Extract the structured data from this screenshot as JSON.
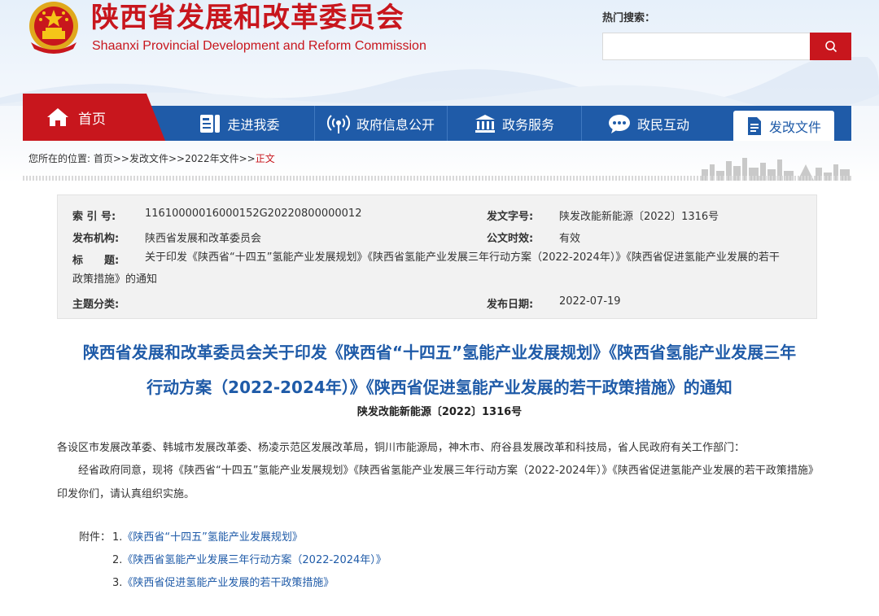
{
  "header": {
    "site_title": "陕西省发展和改革委员会",
    "site_subtitle": "Shaanxi Provincial Development and Reform Commission",
    "search_label": "热门搜索：",
    "search_placeholder": "",
    "search_icon": "search-icon"
  },
  "colors": {
    "brand_red": "#c8161d",
    "nav_blue": "#1f5ba8"
  },
  "nav": {
    "home": "首页",
    "items": [
      "走进我委",
      "政府信息公开",
      "政务服务",
      "政民互动"
    ],
    "active": "发改文件"
  },
  "breadcrumb": {
    "prefix": "您所在的位置: ",
    "path": "首页>>发改文件>>2022年文件>>",
    "current": "正文"
  },
  "info": {
    "index_label": "索 引 号:",
    "index_value": "11610000016000152G20220800000012",
    "doc_no_label": "发文字号:",
    "doc_no_value": "陕发改能新能源〔2022〕1316号",
    "org_label": "发布机构:",
    "org_value": "陕西省发展和改革委员会",
    "validity_label": "公文时效:",
    "validity_value": "有效",
    "title_label": "标　　题:",
    "title_value": "关于印发《陕西省“十四五”氢能产业发展规划》《陕西省氢能产业发展三年行动方案（2022-2024年）》《陕西省促进氢能产业发展的若干政策措施》的通知",
    "category_label": "主题分类:",
    "category_value": "",
    "date_label": "发布日期:",
    "date_value": "2022-07-19"
  },
  "article": {
    "title_line1": "陕西省发展和改革委员会关于印发《陕西省“十四五”氢能产业发展规划》《陕西省氢能产业发展三年",
    "title_line2": "行动方案（2022-2024年）》《陕西省促进氢能产业发展的若干政策措施》的通知",
    "doc_number": "陕发改能新能源〔2022〕1316号",
    "recipients": "各设区市发展改革委、韩城市发展改革委、杨凌示范区发展改革局，铜川市能源局，神木市、府谷县发展改革和科技局，省人民政府有关工作部门：",
    "body": "经省政府同意，现将《陕西省“十四五”氢能产业发展规划》《陕西省氢能产业发展三年行动方案（2022-2024年）》《陕西省促进氢能产业发展的若干政策措施》印发你们，请认真组织实施。",
    "attachment_label": "附件：",
    "attachments": [
      {
        "num": "1.",
        "text": "《陕西省“十四五”氢能产业发展规划》"
      },
      {
        "num": "2.",
        "text": "《陕西省氢能产业发展三年行动方案（2022-2024年）》"
      },
      {
        "num": "3.",
        "text": "《陕西省促进氢能产业发展的若干政策措施》"
      }
    ]
  }
}
